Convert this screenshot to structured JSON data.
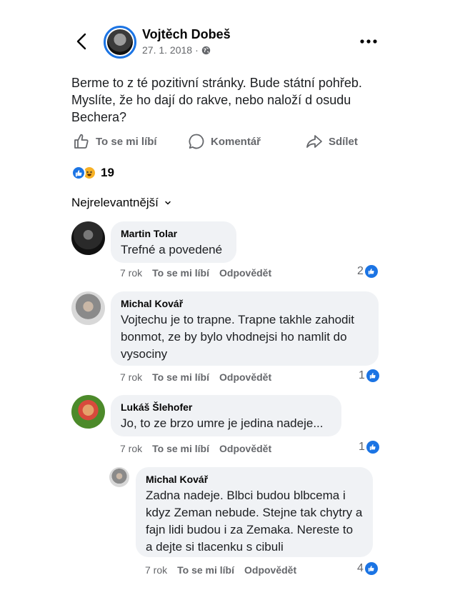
{
  "post": {
    "author": "Vojtěch Dobeš",
    "date": "27. 1. 2018",
    "separator": "·",
    "text": "Berme to z té pozitivní stránky. Bude státní pohřeb. Myslíte, že ho dají do rakve, nebo naloží d osudu Bechera?",
    "audience_icon": "globe-icon"
  },
  "actions": {
    "like": "To se mi líbí",
    "comment": "Komentář",
    "share": "Sdílet"
  },
  "reactions": {
    "types": [
      "like",
      "haha"
    ],
    "count": "19"
  },
  "sort_label": "Nejrelevantnější",
  "colors": {
    "accent": "#1b74e4",
    "bubble": "#f0f2f5",
    "muted": "#65676b"
  },
  "comments": [
    {
      "name": "Martin Tolar",
      "text": "Trefné a povedené",
      "age": "7 rok",
      "like": "To se mi líbí",
      "reply": "Odpovědět",
      "likes": "2"
    },
    {
      "name": "Michal Kovář",
      "text": "Vojtechu je to trapne. Trapne takhle zahodit bonmot, ze by bylo vhodnejsi ho namlit do vysociny",
      "age": "7 rok",
      "like": "To se mi líbí",
      "reply": "Odpovědět",
      "likes": "1"
    },
    {
      "name": "Lukáš Šlehofer",
      "text": "Jo, to ze brzo umre je jedina nadeje...",
      "age": "7 rok",
      "like": "To se mi líbí",
      "reply": "Odpovědět",
      "likes": "1"
    },
    {
      "name": "Michal Kovář",
      "text": "Zadna nadeje. Blbci budou blbcema i kdyz Zeman nebude. Stejne tak chytry a fajn lidi budou i za Zemaka. Nereste to a dejte si tlacenku s cibuli",
      "age": "7 rok",
      "like": "To se mi líbí",
      "reply": "Odpovědět",
      "likes": "4"
    }
  ]
}
